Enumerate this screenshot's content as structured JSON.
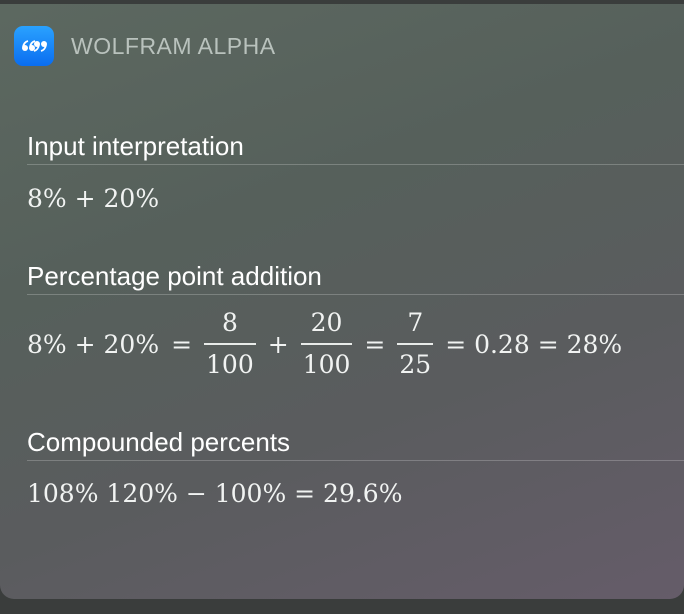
{
  "app": {
    "name": "WOLFRAM ALPHA",
    "icon": "quote-bubble-icon",
    "icon_color": "#1a8cff"
  },
  "pods": {
    "input": {
      "title": "Input interpretation",
      "value": "8% + 20%"
    },
    "percentage_point": {
      "title": "Percentage point addition",
      "lhs": "8% + 20%",
      "eq1": "=",
      "frac1": {
        "num": "8",
        "den": "100"
      },
      "plus": "+",
      "frac2": {
        "num": "20",
        "den": "100"
      },
      "eq2": "=",
      "frac3": {
        "num": "7",
        "den": "25"
      },
      "rest": "= 0.28 = 28%"
    },
    "compounded": {
      "title": "Compounded percents",
      "value": "108% 120% − 100% = 29.6%"
    }
  }
}
